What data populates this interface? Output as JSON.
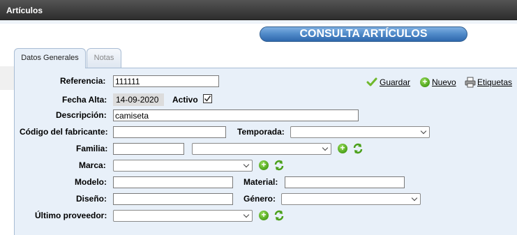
{
  "window": {
    "title": "Artículos"
  },
  "banner": {
    "title": "CONSULTA ARTÍCULOS"
  },
  "tabs": [
    {
      "label": "Datos Generales"
    },
    {
      "label": "Notas"
    }
  ],
  "actions": {
    "guardar": "Guardar",
    "nuevo": "Nuevo",
    "etiquetas": "Etiquetas"
  },
  "form": {
    "referencia": {
      "label": "Referencia:",
      "value": "111111"
    },
    "fecha_alta": {
      "label": "Fecha Alta:",
      "value": "14-09-2020"
    },
    "activo": {
      "label": "Activo",
      "checked": true
    },
    "descripcion": {
      "label": "Descripción:",
      "value": "camiseta"
    },
    "codigo_fabricante": {
      "label": "Código del fabricante:",
      "value": ""
    },
    "temporada": {
      "label": "Temporada:",
      "value": ""
    },
    "familia": {
      "label": "Familia:",
      "value": ""
    },
    "marca": {
      "label": "Marca:",
      "value": ""
    },
    "modelo": {
      "label": "Modelo:",
      "value": ""
    },
    "material": {
      "label": "Material:",
      "value": ""
    },
    "diseno": {
      "label": "Diseño:",
      "value": ""
    },
    "genero": {
      "label": "Género:",
      "value": ""
    },
    "ultimo_proveedor": {
      "label": "Último proveedor:",
      "value": ""
    }
  },
  "colors": {
    "panel_bg": "#e8f0f9",
    "banner_blue": "#4f89c8",
    "add_green": "#4aa019",
    "titlebar": "#3a3a3a"
  }
}
